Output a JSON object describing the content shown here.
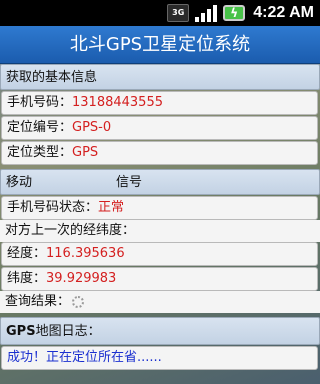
{
  "status_bar": {
    "network": "3G",
    "time": "4:22 AM",
    "icons": [
      "3g-icon",
      "signal-icon",
      "battery-charging-icon"
    ]
  },
  "app": {
    "title": "北斗GPS卫星定位系统"
  },
  "basic_info": {
    "header": "获取的基本信息",
    "phone_label": "手机号码：",
    "phone_value": "13188443555",
    "id_label": "定位编号：",
    "id_value": "GPS-0",
    "type_label": "定位类型：",
    "type_value": "GPS"
  },
  "signal_section": {
    "left": "移动",
    "right": "信号"
  },
  "status": {
    "phone_status_label": "手机号码状态：",
    "phone_status_value": "正常",
    "last_coords_label": "对方上一次的经纬度：",
    "lon_label": "经度：",
    "lon_value": "116.395636",
    "lat_label": "纬度：",
    "lat_value": "39.929983",
    "query_label": "查询结果："
  },
  "log": {
    "header_bold": "GPS",
    "header_rest": "地图日志：",
    "message": "成功！正在定位所在省......"
  },
  "colors": {
    "accent": "#1b5cae",
    "value_red": "#d42020",
    "log_blue": "#1a2fd0"
  }
}
